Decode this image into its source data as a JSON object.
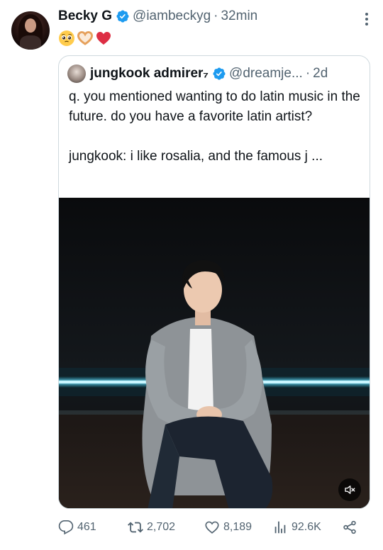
{
  "author": {
    "name": "Becky G",
    "handle": "@iambeckyg",
    "separator": "·",
    "time": "32min"
  },
  "tweet": {
    "emojis": [
      "pleading-face",
      "heart-hands",
      "red-heart"
    ]
  },
  "quoted": {
    "name": "jungkook admirer₇",
    "handle": "@dreamje...",
    "separator": "·",
    "time": "2d",
    "text": "q. you mentioned wanting to do latin music in the future. do you have a favorite latin artist?\n\njungkook: i like rosalia, and the famous j ..."
  },
  "actions": {
    "replies": "461",
    "reposts": "2,702",
    "likes": "8,189",
    "views": "92.6K"
  },
  "colors": {
    "verified": "#1d9bf0",
    "muted_text": "#536471",
    "border": "#cfd9de"
  }
}
